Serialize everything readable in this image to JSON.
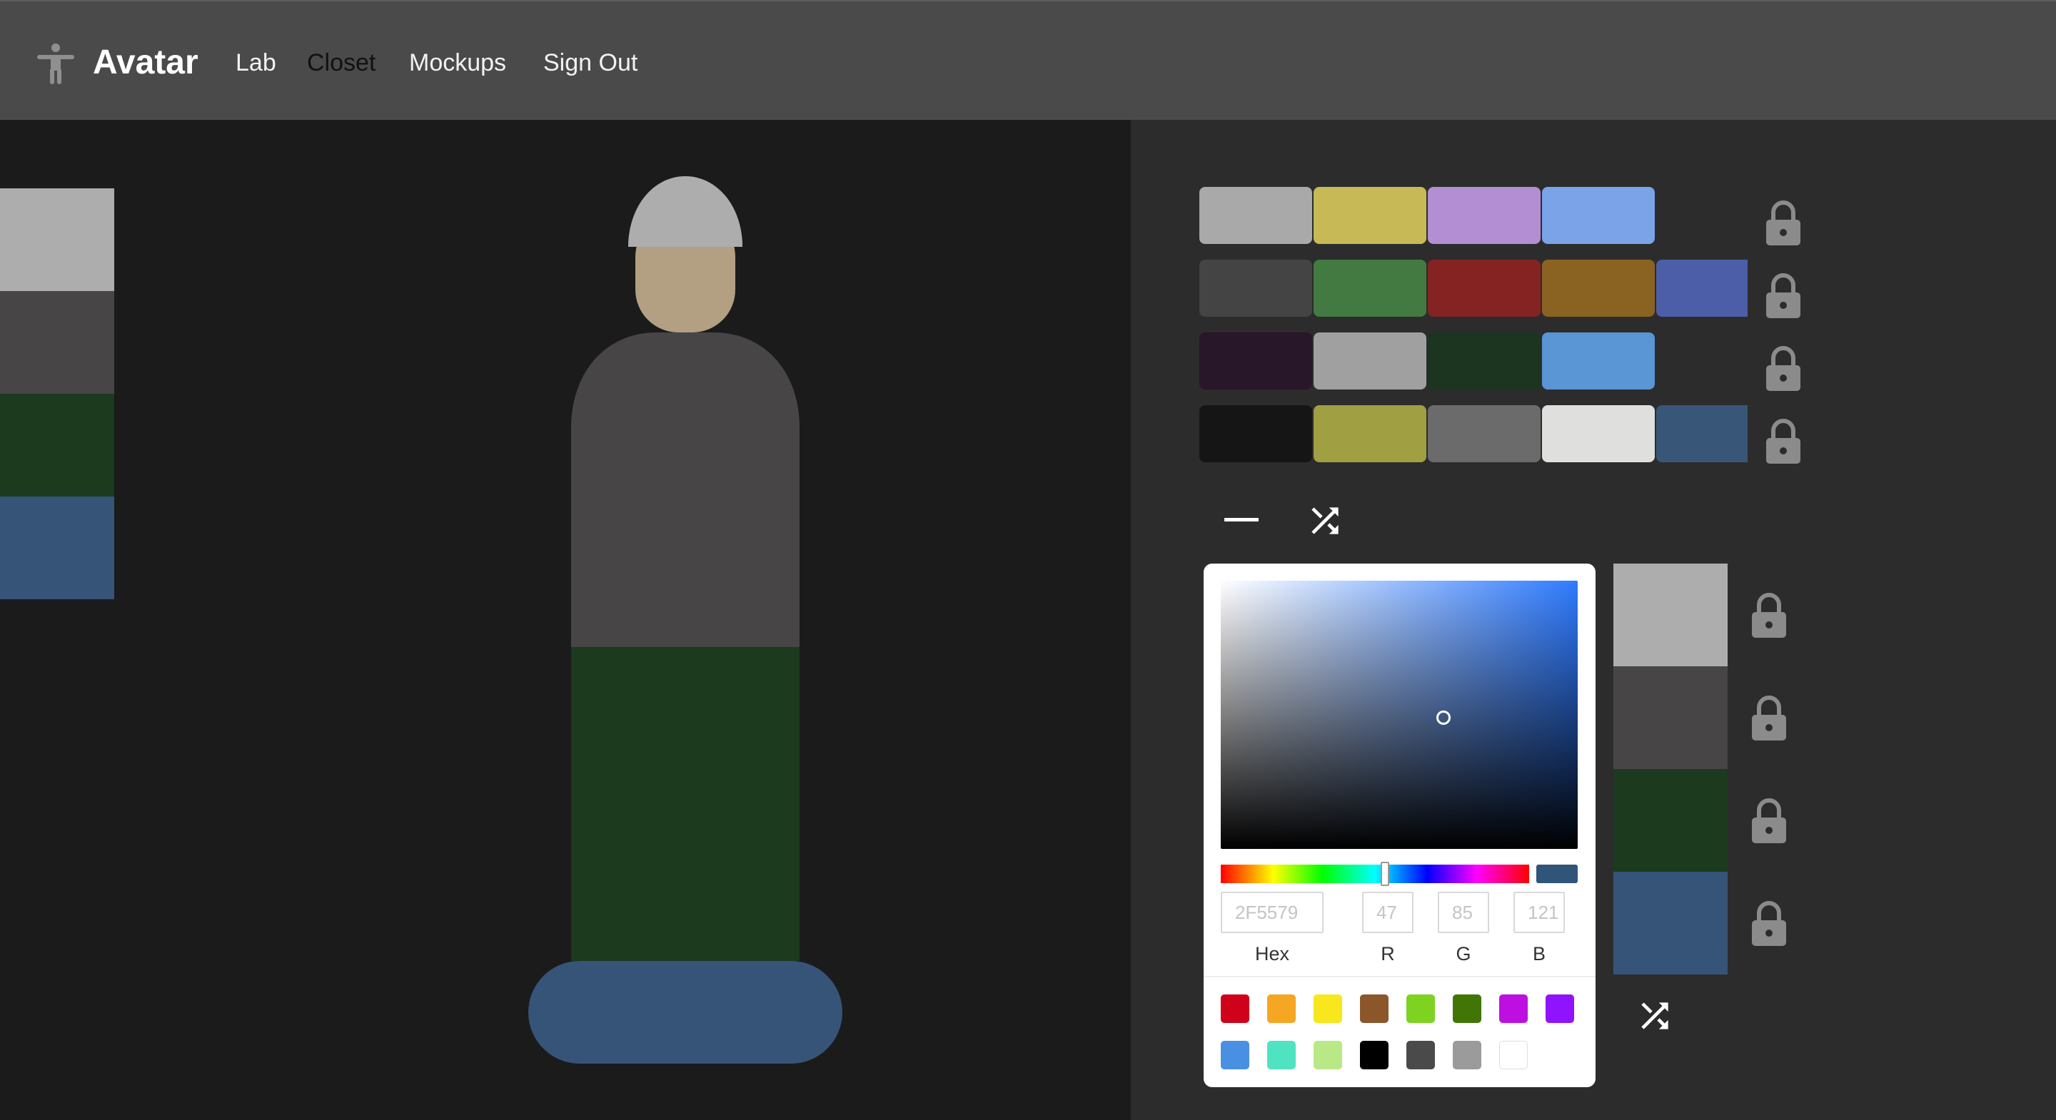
{
  "nav": {
    "brand": "Avatar",
    "links": [
      "Lab",
      "Closet",
      "Mockups",
      "Sign Out"
    ],
    "active": "Closet"
  },
  "colors": {
    "navbar_bg": "#4a4a4a",
    "stage_bg": "#1b1b1b",
    "panel_bg": "#2c2c2c",
    "hat": "#adadad",
    "skin": "#b39f82",
    "shirt": "#474546",
    "pants": "#1b3a1e",
    "shoes": "#365478",
    "lock_icon": "#8b8b8b"
  },
  "outfit_preview": [
    "#adadad",
    "#474546",
    "#1b3a1e",
    "#365478"
  ],
  "palettes": [
    [
      "#a9a9a9",
      "#c7b955",
      "#b38ed3",
      "#7aa3e8"
    ],
    [
      "#444444",
      "#427a42",
      "#852222",
      "#8a6222",
      "#4d5ea8"
    ],
    [
      "#281629",
      "#a0a0a0",
      "#1b3520",
      "#5a95d6"
    ],
    [
      "#151515",
      "#a09f42",
      "#6b6b6b",
      "#dfe0de",
      "#385677"
    ]
  ],
  "icons": {
    "brand": "accessibility-icon",
    "lock": "lock-icon",
    "remove": "minus-icon",
    "shuffle": "shuffle-icon"
  },
  "picker": {
    "hex": "2F5579",
    "r": "47",
    "g": "85",
    "b": "121",
    "labels": {
      "hex": "Hex",
      "r": "R",
      "g": "G",
      "b": "B"
    },
    "selected_color": "#2f5579",
    "presets": [
      "#d0021b",
      "#f5a623",
      "#f8e71c",
      "#8b572a",
      "#7ed321",
      "#417505",
      "#bd10e0",
      "#9013fe",
      "#4a90e2",
      "#50e3c2",
      "#b8e986",
      "#000000",
      "#4a4a4a",
      "#9b9b9b",
      "#ffffff"
    ]
  },
  "current_outfit": [
    "#adadad",
    "#474546",
    "#1b3a1e",
    "#365478"
  ]
}
